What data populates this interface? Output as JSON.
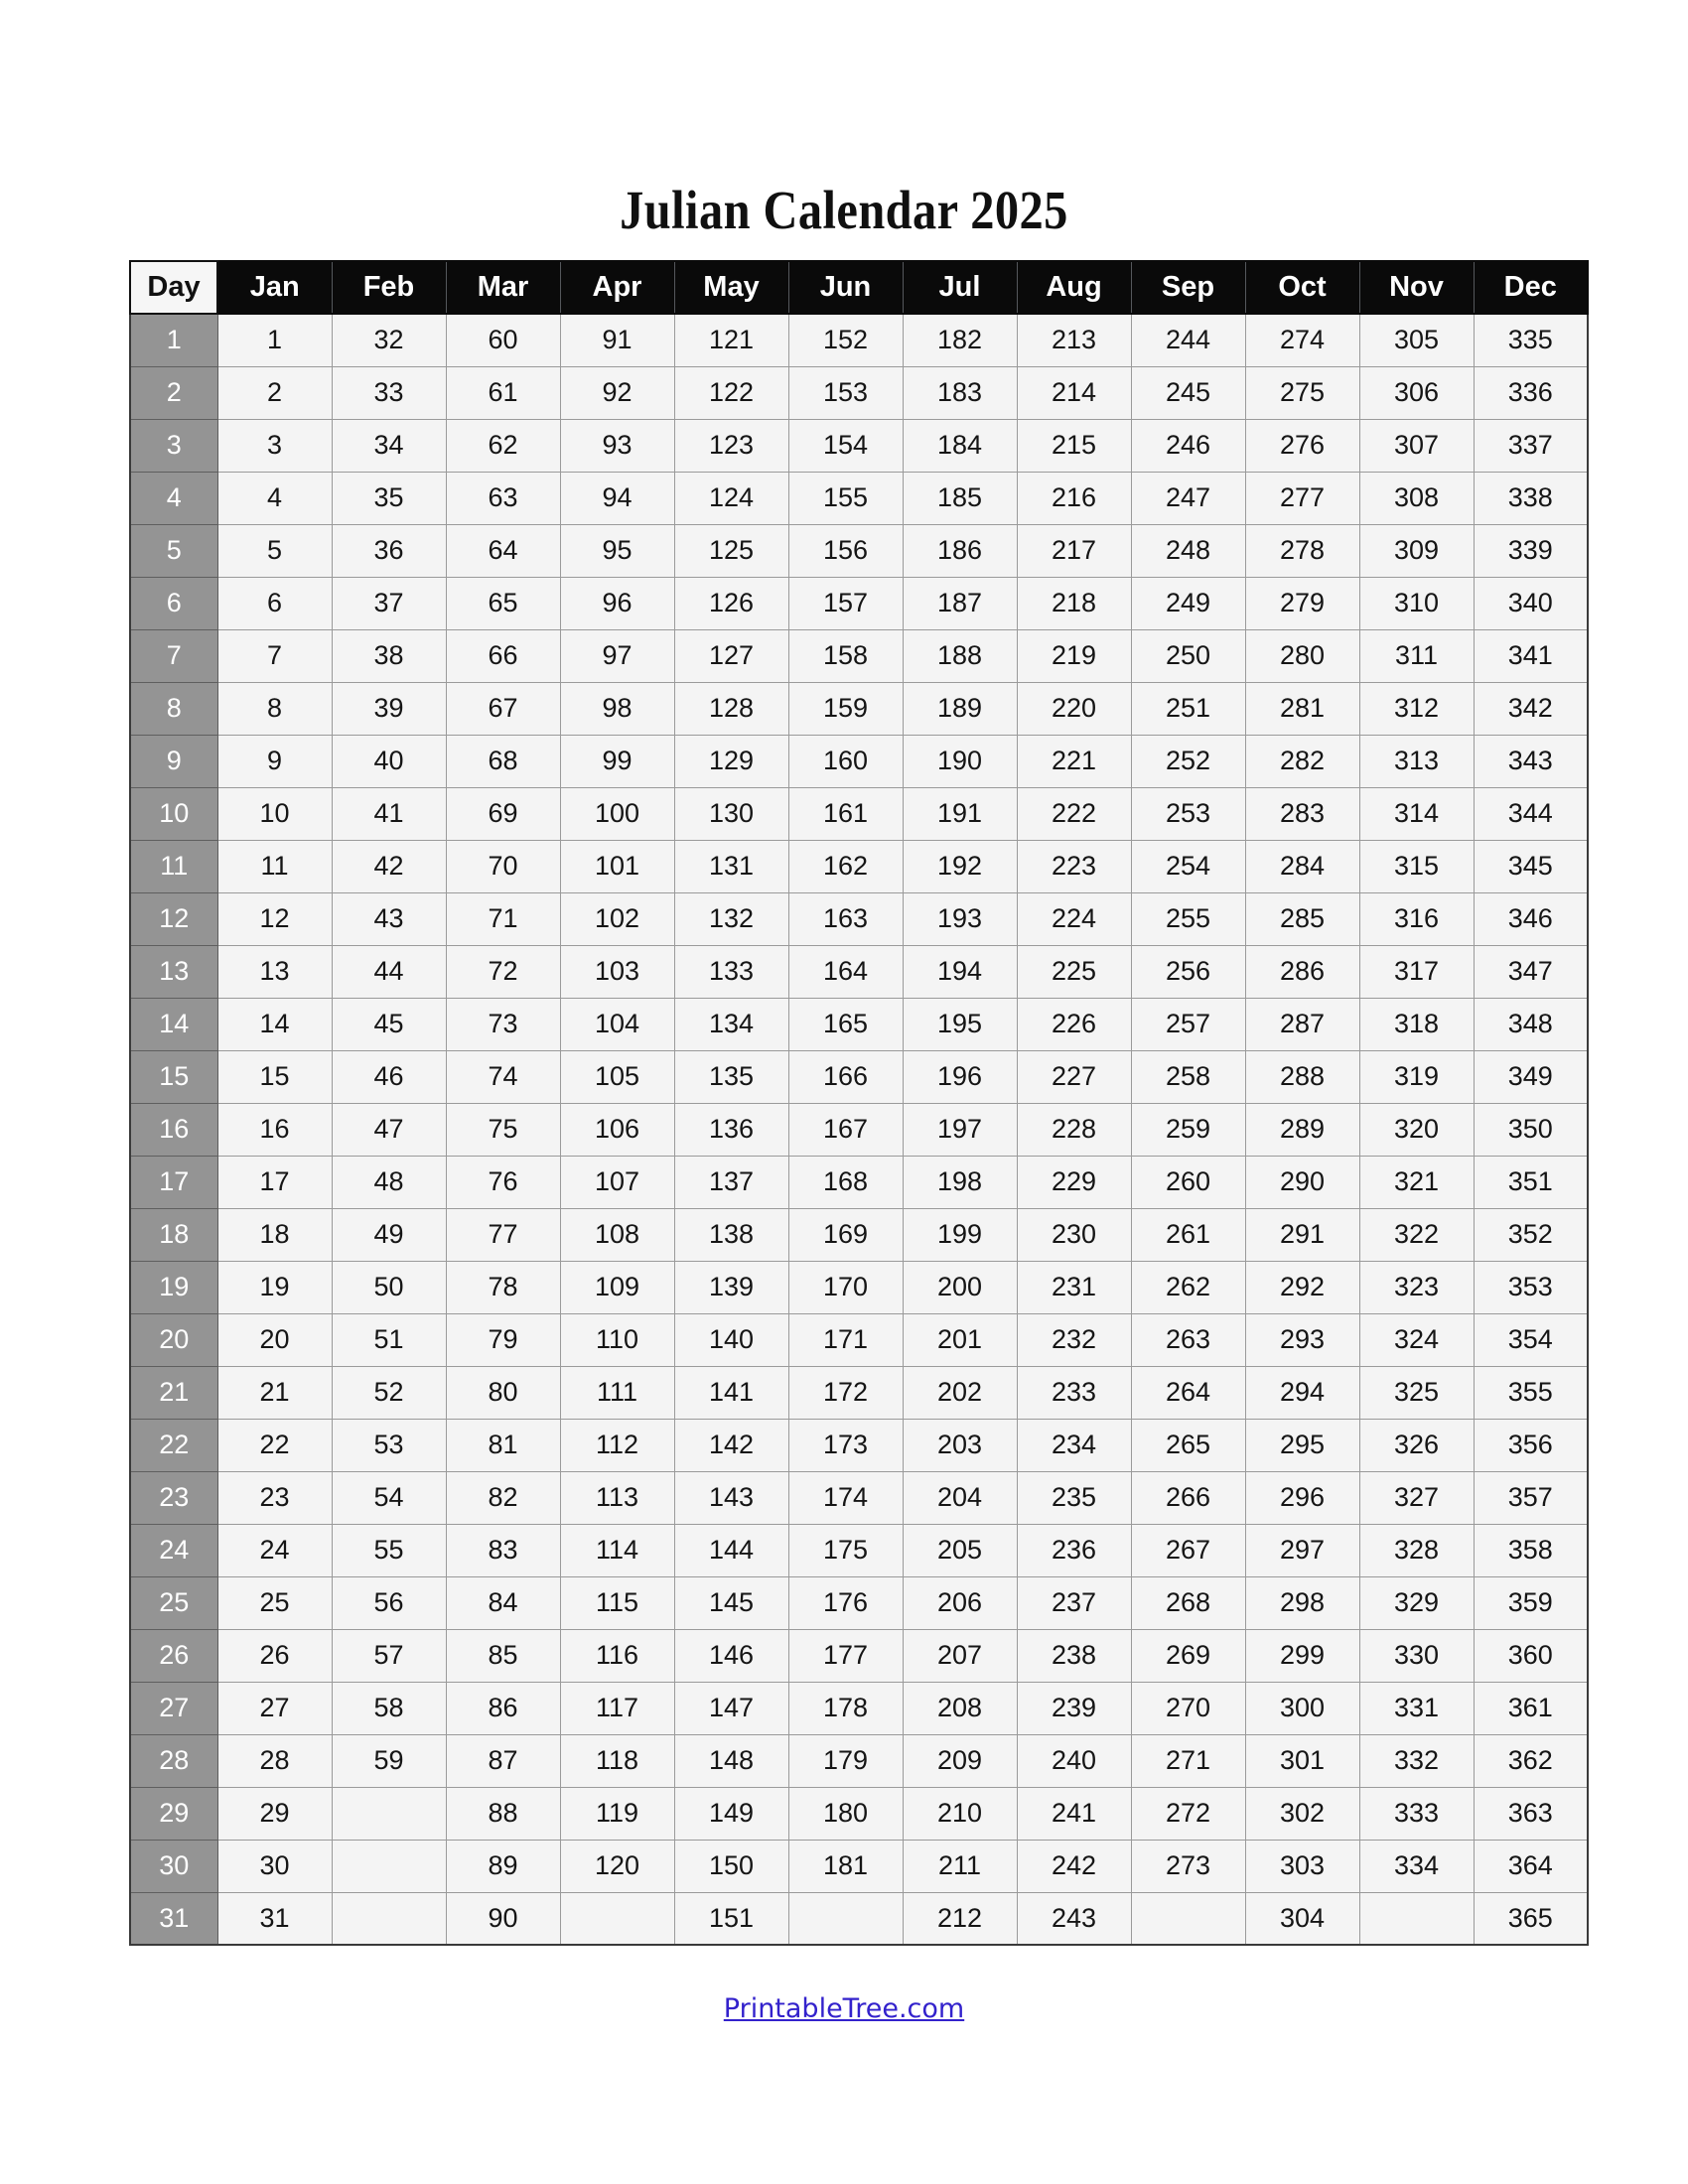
{
  "document": {
    "title": "Julian Calendar 2025",
    "year": "2025"
  },
  "table": {
    "day_header": "Day",
    "months": [
      "Jan",
      "Feb",
      "Mar",
      "Apr",
      "May",
      "Jun",
      "Jul",
      "Aug",
      "Sep",
      "Oct",
      "Nov",
      "Dec"
    ],
    "day_labels": [
      "1",
      "2",
      "3",
      "4",
      "5",
      "6",
      "7",
      "8",
      "9",
      "10",
      "11",
      "12",
      "13",
      "14",
      "15",
      "16",
      "17",
      "18",
      "19",
      "20",
      "21",
      "22",
      "23",
      "24",
      "25",
      "26",
      "27",
      "28",
      "29",
      "30",
      "31"
    ],
    "rows": [
      {
        "day": "1",
        "values": [
          "1",
          "32",
          "60",
          "91",
          "121",
          "152",
          "182",
          "213",
          "244",
          "274",
          "305",
          "335"
        ]
      },
      {
        "day": "2",
        "values": [
          "2",
          "33",
          "61",
          "92",
          "122",
          "153",
          "183",
          "214",
          "245",
          "275",
          "306",
          "336"
        ]
      },
      {
        "day": "3",
        "values": [
          "3",
          "34",
          "62",
          "93",
          "123",
          "154",
          "184",
          "215",
          "246",
          "276",
          "307",
          "337"
        ]
      },
      {
        "day": "4",
        "values": [
          "4",
          "35",
          "63",
          "94",
          "124",
          "155",
          "185",
          "216",
          "247",
          "277",
          "308",
          "338"
        ]
      },
      {
        "day": "5",
        "values": [
          "5",
          "36",
          "64",
          "95",
          "125",
          "156",
          "186",
          "217",
          "248",
          "278",
          "309",
          "339"
        ]
      },
      {
        "day": "6",
        "values": [
          "6",
          "37",
          "65",
          "96",
          "126",
          "157",
          "187",
          "218",
          "249",
          "279",
          "310",
          "340"
        ]
      },
      {
        "day": "7",
        "values": [
          "7",
          "38",
          "66",
          "97",
          "127",
          "158",
          "188",
          "219",
          "250",
          "280",
          "311",
          "341"
        ]
      },
      {
        "day": "8",
        "values": [
          "8",
          "39",
          "67",
          "98",
          "128",
          "159",
          "189",
          "220",
          "251",
          "281",
          "312",
          "342"
        ]
      },
      {
        "day": "9",
        "values": [
          "9",
          "40",
          "68",
          "99",
          "129",
          "160",
          "190",
          "221",
          "252",
          "282",
          "313",
          "343"
        ]
      },
      {
        "day": "10",
        "values": [
          "10",
          "41",
          "69",
          "100",
          "130",
          "161",
          "191",
          "222",
          "253",
          "283",
          "314",
          "344"
        ]
      },
      {
        "day": "11",
        "values": [
          "11",
          "42",
          "70",
          "101",
          "131",
          "162",
          "192",
          "223",
          "254",
          "284",
          "315",
          "345"
        ]
      },
      {
        "day": "12",
        "values": [
          "12",
          "43",
          "71",
          "102",
          "132",
          "163",
          "193",
          "224",
          "255",
          "285",
          "316",
          "346"
        ]
      },
      {
        "day": "13",
        "values": [
          "13",
          "44",
          "72",
          "103",
          "133",
          "164",
          "194",
          "225",
          "256",
          "286",
          "317",
          "347"
        ]
      },
      {
        "day": "14",
        "values": [
          "14",
          "45",
          "73",
          "104",
          "134",
          "165",
          "195",
          "226",
          "257",
          "287",
          "318",
          "348"
        ]
      },
      {
        "day": "15",
        "values": [
          "15",
          "46",
          "74",
          "105",
          "135",
          "166",
          "196",
          "227",
          "258",
          "288",
          "319",
          "349"
        ]
      },
      {
        "day": "16",
        "values": [
          "16",
          "47",
          "75",
          "106",
          "136",
          "167",
          "197",
          "228",
          "259",
          "289",
          "320",
          "350"
        ]
      },
      {
        "day": "17",
        "values": [
          "17",
          "48",
          "76",
          "107",
          "137",
          "168",
          "198",
          "229",
          "260",
          "290",
          "321",
          "351"
        ]
      },
      {
        "day": "18",
        "values": [
          "18",
          "49",
          "77",
          "108",
          "138",
          "169",
          "199",
          "230",
          "261",
          "291",
          "322",
          "352"
        ]
      },
      {
        "day": "19",
        "values": [
          "19",
          "50",
          "78",
          "109",
          "139",
          "170",
          "200",
          "231",
          "262",
          "292",
          "323",
          "353"
        ]
      },
      {
        "day": "20",
        "values": [
          "20",
          "51",
          "79",
          "110",
          "140",
          "171",
          "201",
          "232",
          "263",
          "293",
          "324",
          "354"
        ]
      },
      {
        "day": "21",
        "values": [
          "21",
          "52",
          "80",
          "111",
          "141",
          "172",
          "202",
          "233",
          "264",
          "294",
          "325",
          "355"
        ]
      },
      {
        "day": "22",
        "values": [
          "22",
          "53",
          "81",
          "112",
          "142",
          "173",
          "203",
          "234",
          "265",
          "295",
          "326",
          "356"
        ]
      },
      {
        "day": "23",
        "values": [
          "23",
          "54",
          "82",
          "113",
          "143",
          "174",
          "204",
          "235",
          "266",
          "296",
          "327",
          "357"
        ]
      },
      {
        "day": "24",
        "values": [
          "24",
          "55",
          "83",
          "114",
          "144",
          "175",
          "205",
          "236",
          "267",
          "297",
          "328",
          "358"
        ]
      },
      {
        "day": "25",
        "values": [
          "25",
          "56",
          "84",
          "115",
          "145",
          "176",
          "206",
          "237",
          "268",
          "298",
          "329",
          "359"
        ]
      },
      {
        "day": "26",
        "values": [
          "26",
          "57",
          "85",
          "116",
          "146",
          "177",
          "207",
          "238",
          "269",
          "299",
          "330",
          "360"
        ]
      },
      {
        "day": "27",
        "values": [
          "27",
          "58",
          "86",
          "117",
          "147",
          "178",
          "208",
          "239",
          "270",
          "300",
          "331",
          "361"
        ]
      },
      {
        "day": "28",
        "values": [
          "28",
          "59",
          "87",
          "118",
          "148",
          "179",
          "209",
          "240",
          "271",
          "301",
          "332",
          "362"
        ]
      },
      {
        "day": "29",
        "values": [
          "29",
          "",
          "88",
          "119",
          "149",
          "180",
          "210",
          "241",
          "272",
          "302",
          "333",
          "363"
        ]
      },
      {
        "day": "30",
        "values": [
          "30",
          "",
          "89",
          "120",
          "150",
          "181",
          "211",
          "242",
          "273",
          "303",
          "334",
          "364"
        ]
      },
      {
        "day": "31",
        "values": [
          "31",
          "",
          "90",
          "",
          "151",
          "",
          "212",
          "243",
          "",
          "304",
          "",
          "365"
        ]
      }
    ]
  },
  "footer": {
    "link_text": "PrintableTree.com"
  },
  "colors": {
    "header_background": "#0a0a0a",
    "header_text": "#ffffff",
    "day_column_background": "#949494",
    "day_column_text": "#ffffff",
    "cell_background": "#f4f4f4",
    "cell_text": "#151515",
    "link": "#3322cc",
    "page_background": "#ffffff"
  }
}
